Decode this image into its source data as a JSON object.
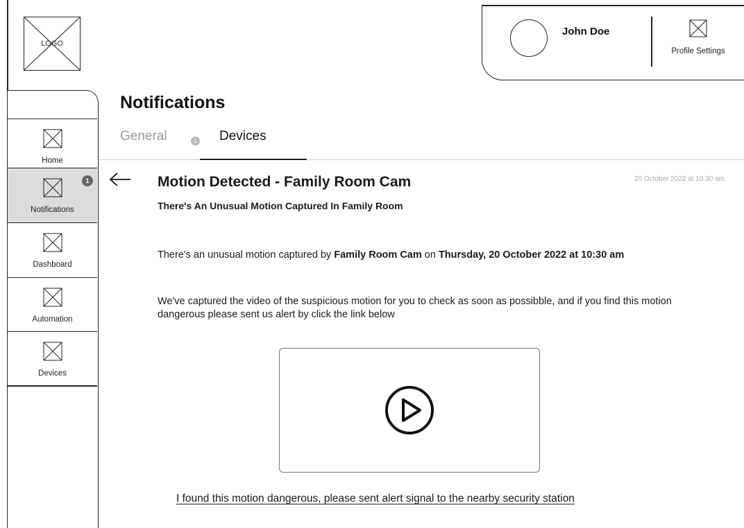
{
  "logo": {
    "text": "LOGO"
  },
  "profile": {
    "user_name": "John Doe",
    "settings_label": "Profile Settings"
  },
  "sidebar": {
    "items": [
      {
        "label": "Home",
        "icon": "placeholder-icon",
        "active": false
      },
      {
        "label": "Notifications",
        "icon": "placeholder-icon",
        "active": true,
        "badge": "1"
      },
      {
        "label": "Dashboard",
        "icon": "placeholder-icon",
        "active": false
      },
      {
        "label": "Automation",
        "icon": "placeholder-icon",
        "active": false
      },
      {
        "label": "Devices",
        "icon": "placeholder-icon",
        "active": false
      }
    ]
  },
  "page": {
    "title": "Notifications",
    "tabs": [
      {
        "label": "General",
        "badge": "1",
        "active": false
      },
      {
        "label": "Devices",
        "active": true
      }
    ]
  },
  "message": {
    "title": "Motion Detected - Family Room Cam",
    "date": "20 October 2022 at 10:30 am",
    "subtitle": "There's An Unusual Motion Captured In Family Room",
    "p1_pre": "There's an unusual motion captured by ",
    "p1_camera": "Family Room Cam",
    "p1_mid": " on ",
    "p1_datetime": "Thursday, 20 October 2022 at 10:30 am",
    "p2": "We've captured the video of the suspicious motion for you to check as soon as possibble, and if you find this motion dangerous please sent us alert by click the link below",
    "video_icon": "play-icon",
    "alert_link": "I found this motion dangerous, please sent alert signal to the nearby security station"
  },
  "colors": {
    "active_sidebar": "#dcdcdc",
    "badge": "#666666",
    "muted_text": "#9a9a9a"
  }
}
